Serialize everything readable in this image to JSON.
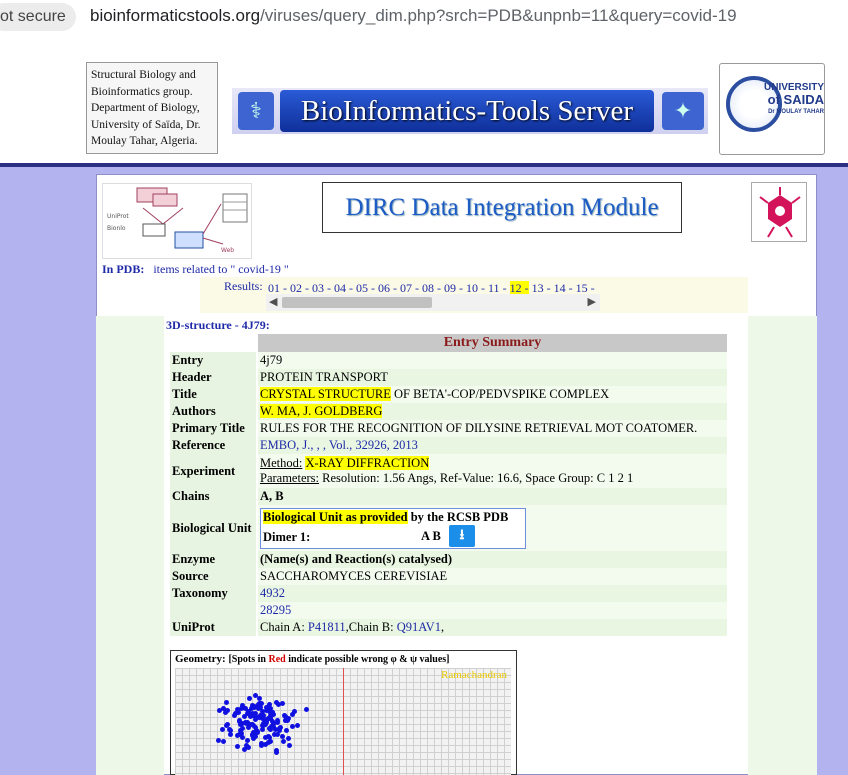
{
  "browser": {
    "security_label": "ot secure",
    "url_host": "bioinformaticstools.org",
    "url_path": "/viruses/query_dim.php?srch=PDB&unpnb=11&query=covid-19"
  },
  "header": {
    "group_lines": [
      "Structural Biology and",
      "Bioinformatics group.",
      "Department of Biology,",
      "University of Saïda, Dr.",
      "Moulay Tahar, Algeria."
    ],
    "banner_title": "BioInformatics-Tools Server",
    "uni_line1": "UNIVERSITY",
    "uni_line2": "of SAIDA",
    "uni_line3": "Dr MOULAY TAHAR"
  },
  "module": {
    "title": "DIRC Data Integration Module"
  },
  "search": {
    "in_pdb_label": "In PDB:",
    "items_text": "items related to \" covid-19 \"",
    "results_label": "Results:",
    "pages": [
      "01",
      "02",
      "03",
      "04",
      "05",
      "06",
      "07",
      "08",
      "09",
      "10",
      "11",
      "12",
      "13",
      "14",
      "15"
    ],
    "highlighted_page": "12"
  },
  "structure": {
    "heading": "3D-structure - 4J79:",
    "summary_title": "Entry Summary",
    "entry": "4j79",
    "header_val": "PROTEIN TRANSPORT",
    "title_hl": "CRYSTAL STRUCTURE",
    "title_rest": " OF BETA'-COP/PEDVSPIKE COMPLEX",
    "authors": "W. MA, J. GOLDBERG",
    "primary_title": "RULES FOR THE RECOGNITION OF DILYSINE RETRIEVAL MOT COATOMER.",
    "reference": "EMBO, J., , , Vol., 32926, 2013",
    "method_label": "Method:",
    "method_value": "X-RAY DIFFRACTION",
    "params_label": "Parameters:",
    "params_value": " Resolution: 1.56 Angs, Ref-Value: 16.6, Space Group: C 1 2 1",
    "chains": "A, B",
    "bio_unit_hl": "Biological Unit as provided",
    "bio_unit_rest": " by the RCSB PDB",
    "dimer_label": "Dimer 1:",
    "dimer_chains": "A B",
    "enzyme": "(Name(s) and Reaction(s) catalysed)",
    "source": "SACCHAROMYCES CEREVISIAE",
    "taxonomy": [
      "4932",
      "28295"
    ],
    "uniprot_a_prefix": "Chain A: ",
    "uniprot_a": "P41811",
    "uniprot_b_prefix": ",Chain B: ",
    "uniprot_b": "Q91AV1",
    "uniprot_suffix": ",",
    "labels": {
      "entry": "Entry",
      "header": "Header",
      "title": "Title",
      "authors": "Authors",
      "primary_title": "Primary Title",
      "reference": "Reference",
      "experiment": "Experiment",
      "chains": "Chains",
      "bio_unit": "Biological Unit",
      "enzyme": "Enzyme",
      "source": "Source",
      "taxonomy": "Taxonomy",
      "uniprot": "UniProt"
    }
  },
  "geometry": {
    "label": "Geometry:",
    "note_pre": "[Spots in ",
    "note_red": "Red",
    "note_post": " indicate possible wrong φ & ψ values]",
    "plot_label": "Ramachandran"
  }
}
